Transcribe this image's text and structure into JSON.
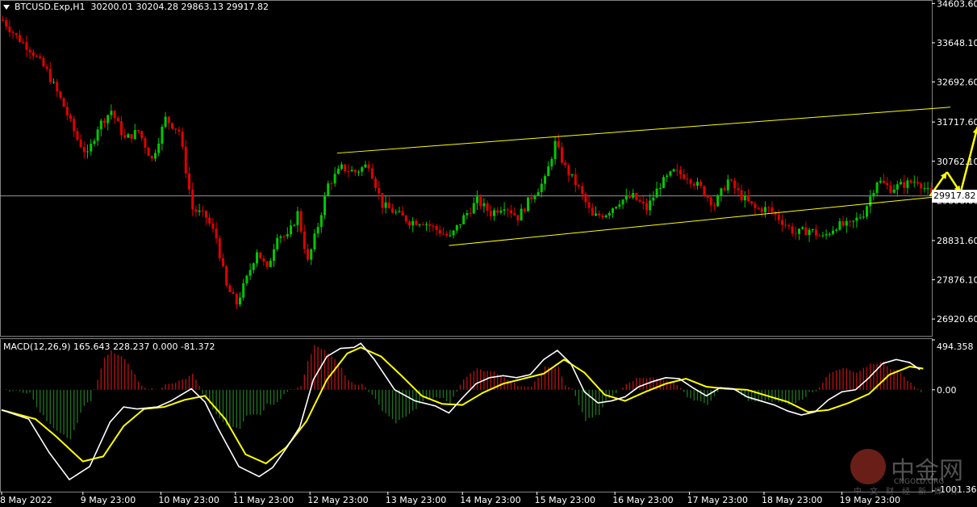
{
  "header": {
    "symbol": "BTCUSD.Exp,H1",
    "ohlc": "30200.01 30204.28 29863.13 29917.82"
  },
  "macd_header": "MACD(12,26,9) 165.643 228.237 0.000 -81.372",
  "current_price": "29917.82",
  "logo": {
    "brand": "中金网",
    "domain": "CNGOLD.ORG",
    "tagline": "中文财经新媒体"
  },
  "colors": {
    "bull": "#00c800",
    "bear": "#e00000",
    "channel": "#ffff00",
    "macd_line": "#ffffff",
    "signal_line": "#ffff00",
    "hist_pos": "#b01010",
    "hist_neg": "#1e6e1e",
    "grid": "#ffffff"
  },
  "chart_data": [
    {
      "type": "candlestick",
      "title": "BTCUSD.Exp,H1",
      "y_ticks": [
        "34603.60",
        "33648.10",
        "32692.60",
        "31717.60",
        "30762.10",
        "29806.60",
        "28831.60",
        "27876.10",
        "26920.60"
      ],
      "x_ticks": [
        "8 May 2022",
        "9 May 23:00",
        "10 May 23:00",
        "11 May 23:00",
        "12 May 23:00",
        "13 May 23:00",
        "14 May 23:00",
        "15 May 23:00",
        "16 May 23:00",
        "17 May 23:00",
        "18 May 23:00",
        "19 May 23:00"
      ],
      "ylim": [
        26550,
        34650
      ],
      "close_path": [
        [
          0,
          34200
        ],
        [
          4,
          33800
        ],
        [
          8,
          33500
        ],
        [
          13,
          32950
        ],
        [
          18,
          32100
        ],
        [
          22,
          31300
        ],
        [
          25,
          30900
        ],
        [
          28,
          31600
        ],
        [
          32,
          32000
        ],
        [
          36,
          31300
        ],
        [
          40,
          31500
        ],
        [
          44,
          30800
        ],
        [
          48,
          31800
        ],
        [
          52,
          31500
        ],
        [
          56,
          29600
        ],
        [
          60,
          29400
        ],
        [
          63,
          28900
        ],
        [
          66,
          27700
        ],
        [
          69,
          27300
        ],
        [
          72,
          27900
        ],
        [
          75,
          28600
        ],
        [
          78,
          28100
        ],
        [
          81,
          29000
        ],
        [
          84,
          28900
        ],
        [
          87,
          29500
        ],
        [
          90,
          28300
        ],
        [
          93,
          29200
        ],
        [
          96,
          30200
        ],
        [
          100,
          30600
        ],
        [
          104,
          30500
        ],
        [
          108,
          30700
        ],
        [
          112,
          29700
        ],
        [
          116,
          29500
        ],
        [
          120,
          29300
        ],
        [
          124,
          29300
        ],
        [
          128,
          29100
        ],
        [
          132,
          28900
        ],
        [
          136,
          29400
        ],
        [
          140,
          29800
        ],
        [
          144,
          29500
        ],
        [
          148,
          29700
        ],
        [
          152,
          29400
        ],
        [
          156,
          29900
        ],
        [
          160,
          30300
        ],
        [
          163,
          31200
        ],
        [
          166,
          30600
        ],
        [
          170,
          30100
        ],
        [
          174,
          29400
        ],
        [
          178,
          29500
        ],
        [
          182,
          29800
        ],
        [
          186,
          29900
        ],
        [
          190,
          29600
        ],
        [
          194,
          30200
        ],
        [
          198,
          30500
        ],
        [
          202,
          30400
        ],
        [
          206,
          30100
        ],
        [
          210,
          29700
        ],
        [
          214,
          30300
        ],
        [
          218,
          29900
        ],
        [
          222,
          29600
        ],
        [
          226,
          29600
        ],
        [
          230,
          29300
        ],
        [
          234,
          29000
        ],
        [
          238,
          29100
        ],
        [
          242,
          28900
        ],
        [
          246,
          29200
        ],
        [
          250,
          29200
        ],
        [
          254,
          29500
        ],
        [
          258,
          30300
        ],
        [
          262,
          30100
        ],
        [
          266,
          30200
        ],
        [
          270,
          30300
        ],
        [
          274,
          29920
        ]
      ],
      "channel": [
        {
          "name": "upper",
          "from": [
            99,
            30960
          ],
          "to": [
            280,
            32080
          ]
        },
        {
          "name": "lower",
          "from": [
            132,
            28710
          ],
          "to": [
            280,
            29930
          ]
        }
      ],
      "projection": [
        [
          274,
          29917
        ],
        [
          279,
          30500
        ],
        [
          283,
          30000
        ],
        [
          288,
          31600
        ],
        [
          293,
          30200
        ]
      ],
      "current_price": 29917.82
    },
    {
      "type": "macd",
      "title": "MACD(12,26,9)",
      "values": {
        "main": 165.643,
        "signal": 228.237,
        "extra1": 0.0,
        "extra2": -81.372
      },
      "y_ticks": [
        "494.358",
        "0.00",
        "-1001.364"
      ],
      "ylim": [
        -1001.364,
        494.358
      ],
      "macd_path": [
        [
          0,
          -200
        ],
        [
          8,
          -290
        ],
        [
          14,
          -620
        ],
        [
          20,
          -890
        ],
        [
          26,
          -760
        ],
        [
          32,
          -320
        ],
        [
          36,
          -170
        ],
        [
          40,
          -190
        ],
        [
          46,
          -170
        ],
        [
          50,
          -110
        ],
        [
          56,
          10
        ],
        [
          60,
          -120
        ],
        [
          64,
          -390
        ],
        [
          70,
          -760
        ],
        [
          76,
          -860
        ],
        [
          80,
          -770
        ],
        [
          84,
          -580
        ],
        [
          88,
          -370
        ],
        [
          92,
          100
        ],
        [
          96,
          330
        ],
        [
          100,
          410
        ],
        [
          104,
          420
        ],
        [
          106,
          460
        ],
        [
          110,
          300
        ],
        [
          116,
          0
        ],
        [
          122,
          -110
        ],
        [
          128,
          -160
        ],
        [
          132,
          -230
        ],
        [
          136,
          -80
        ],
        [
          140,
          60
        ],
        [
          144,
          120
        ],
        [
          148,
          140
        ],
        [
          152,
          120
        ],
        [
          156,
          150
        ],
        [
          160,
          300
        ],
        [
          164,
          390
        ],
        [
          168,
          260
        ],
        [
          172,
          -20
        ],
        [
          176,
          -130
        ],
        [
          180,
          -110
        ],
        [
          184,
          -70
        ],
        [
          188,
          30
        ],
        [
          192,
          80
        ],
        [
          196,
          120
        ],
        [
          200,
          110
        ],
        [
          204,
          20
        ],
        [
          208,
          -60
        ],
        [
          212,
          20
        ],
        [
          216,
          10
        ],
        [
          220,
          -70
        ],
        [
          224,
          -110
        ],
        [
          228,
          -150
        ],
        [
          232,
          -210
        ],
        [
          236,
          -250
        ],
        [
          240,
          -220
        ],
        [
          244,
          -100
        ],
        [
          248,
          -20
        ],
        [
          252,
          0
        ],
        [
          256,
          120
        ],
        [
          260,
          260
        ],
        [
          264,
          300
        ],
        [
          268,
          270
        ],
        [
          271,
          200
        ]
      ],
      "signal_path": [
        [
          0,
          -200
        ],
        [
          10,
          -290
        ],
        [
          16,
          -460
        ],
        [
          24,
          -710
        ],
        [
          30,
          -660
        ],
        [
          36,
          -360
        ],
        [
          42,
          -190
        ],
        [
          48,
          -170
        ],
        [
          54,
          -100
        ],
        [
          60,
          -60
        ],
        [
          66,
          -290
        ],
        [
          72,
          -640
        ],
        [
          78,
          -730
        ],
        [
          84,
          -570
        ],
        [
          90,
          -310
        ],
        [
          96,
          100
        ],
        [
          102,
          360
        ],
        [
          106,
          420
        ],
        [
          112,
          330
        ],
        [
          118,
          140
        ],
        [
          124,
          -60
        ],
        [
          130,
          -140
        ],
        [
          136,
          -150
        ],
        [
          142,
          -30
        ],
        [
          148,
          60
        ],
        [
          154,
          110
        ],
        [
          160,
          160
        ],
        [
          166,
          300
        ],
        [
          172,
          170
        ],
        [
          178,
          -50
        ],
        [
          184,
          -110
        ],
        [
          190,
          -20
        ],
        [
          196,
          60
        ],
        [
          202,
          110
        ],
        [
          208,
          30
        ],
        [
          214,
          10
        ],
        [
          220,
          0
        ],
        [
          226,
          -60
        ],
        [
          232,
          -120
        ],
        [
          238,
          -220
        ],
        [
          244,
          -200
        ],
        [
          250,
          -130
        ],
        [
          256,
          -40
        ],
        [
          262,
          150
        ],
        [
          268,
          230
        ],
        [
          272,
          210
        ]
      ]
    }
  ]
}
